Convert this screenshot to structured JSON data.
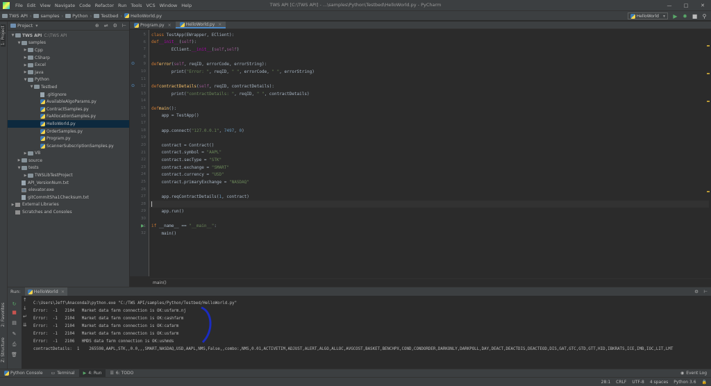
{
  "window": {
    "title": "TWS API [C:\\TWS API] - ...\\samples\\Python\\Testbed\\HelloWorld.py - PyCharm",
    "controls": [
      "—",
      "□",
      "✕"
    ]
  },
  "menu": [
    "File",
    "Edit",
    "View",
    "Navigate",
    "Code",
    "Refactor",
    "Run",
    "Tools",
    "VCS",
    "Window",
    "Help"
  ],
  "breadcrumbs": [
    "TWS API",
    "samples",
    "Python",
    "Testbed",
    "HelloWorld.py"
  ],
  "run_config": "HelloWorld",
  "left_strip": {
    "project": "1: Project",
    "favorites": "2: Favorites",
    "structure": "Z: Structure"
  },
  "project_pane": {
    "title": "Project",
    "tree": [
      {
        "label": "TWS API",
        "extra": "C:\\TWS API",
        "type": "folder",
        "depth": 0,
        "open": true
      },
      {
        "label": "samples",
        "type": "folder",
        "depth": 1,
        "open": true
      },
      {
        "label": "Cpp",
        "type": "folder",
        "depth": 2,
        "open": false
      },
      {
        "label": "CSharp",
        "type": "folder",
        "depth": 2,
        "open": false
      },
      {
        "label": "Excel",
        "type": "folder",
        "depth": 2,
        "open": false
      },
      {
        "label": "Java",
        "type": "folder",
        "depth": 2,
        "open": false
      },
      {
        "label": "Python",
        "type": "folder",
        "depth": 2,
        "open": true
      },
      {
        "label": "Testbed",
        "type": "folder",
        "depth": 3,
        "open": true
      },
      {
        "label": ".gitignore",
        "type": "file",
        "depth": 4
      },
      {
        "label": "AvailableAlgoParams.py",
        "type": "py",
        "depth": 4
      },
      {
        "label": "ContractSamples.py",
        "type": "py",
        "depth": 4
      },
      {
        "label": "FaAllocationSamples.py",
        "type": "py",
        "depth": 4
      },
      {
        "label": "HelloWorld.py",
        "type": "py",
        "depth": 4,
        "selected": true
      },
      {
        "label": "OrderSamples.py",
        "type": "py",
        "depth": 4
      },
      {
        "label": "Program.py",
        "type": "py",
        "depth": 4
      },
      {
        "label": "ScannerSubscriptionSamples.py",
        "type": "py",
        "depth": 4
      },
      {
        "label": "VB",
        "type": "folder",
        "depth": 2,
        "open": false
      },
      {
        "label": "source",
        "type": "folder",
        "depth": 1,
        "open": false
      },
      {
        "label": "tests",
        "type": "folder",
        "depth": 1,
        "open": true
      },
      {
        "label": "TWSLibTestProject",
        "type": "folder",
        "depth": 2,
        "open": false
      },
      {
        "label": "API_VersionNum.txt",
        "type": "file",
        "depth": 1
      },
      {
        "label": "elevator.exe",
        "type": "exe",
        "depth": 1
      },
      {
        "label": "gitCommitSha1Checksum.txt",
        "type": "file",
        "depth": 1
      },
      {
        "label": "External Libraries",
        "type": "lib",
        "depth": 0,
        "open": false
      },
      {
        "label": "Scratches and Consoles",
        "type": "scratch",
        "depth": 0
      }
    ]
  },
  "editor": {
    "tabs": [
      {
        "label": "Program.py",
        "active": false
      },
      {
        "label": "HelloWorld.py",
        "active": true
      }
    ],
    "breadcrumb": "main()",
    "lines": [
      {
        "n": "5",
        "html": "<span class='kw'>class</span> TestApp(EWrapper, EClient):"
      },
      {
        "n": "6",
        "html": "    <span class='kw'>def</span> <span class='magic'>__init__</span>(<span class='self'>self</span>):"
      },
      {
        "n": "7",
        "html": "        EClient.<span class='magic'>__init__</span>(<span class='self'>self</span>,<span class='self'>self</span>)"
      },
      {
        "n": "8",
        "html": ""
      },
      {
        "n": "9",
        "html": "    <span class='kw'>def</span> <span class='fn'>error</span>(<span class='self'>self</span>, reqID, errorCode, errorString):"
      },
      {
        "n": "10",
        "html": "        print(<span class='str'>\"Error: \"</span>, reqID, <span class='str'>\" \"</span>, errorCode, <span class='str'>\" \"</span>, errorString)"
      },
      {
        "n": "11",
        "html": ""
      },
      {
        "n": "12",
        "html": "    <span class='kw'>def</span> <span class='fn'>contractDetails</span>(<span class='self'>self</span>, reqID, contractDetails):"
      },
      {
        "n": "13",
        "html": "        print(<span class='str'>\"contractDetails: \"</span>, reqID, <span class='str'>\" \"</span>, contractDetails)"
      },
      {
        "n": "14",
        "html": ""
      },
      {
        "n": "15",
        "html": "<span class='kw'>def</span> <span class='fn'>main</span>():"
      },
      {
        "n": "16",
        "html": "    app = TestApp()"
      },
      {
        "n": "17",
        "html": ""
      },
      {
        "n": "18",
        "html": "    app.connect(<span class='str'>\"127.0.0.1\"</span>, <span class='num'>7497</span>, <span class='num'>0</span>)"
      },
      {
        "n": "19",
        "html": ""
      },
      {
        "n": "20",
        "html": "    contract = Contract()"
      },
      {
        "n": "21",
        "html": "    contract.symbol = <span class='str'>\"AAPL\"</span>"
      },
      {
        "n": "22",
        "html": "    contract.secType = <span class='str'>\"STK\"</span>"
      },
      {
        "n": "23",
        "html": "    contract.exchange = <span class='str'>\"SMART\"</span>"
      },
      {
        "n": "24",
        "html": "    contract.currency = <span class='str'>\"USD\"</span>"
      },
      {
        "n": "25",
        "html": "    contract.primaryExchange = <span class='str'>\"NASDAQ\"</span>"
      },
      {
        "n": "26",
        "html": ""
      },
      {
        "n": "27",
        "html": "    app.reqContractDetails(<span class='num'>1</span>, contract)"
      },
      {
        "n": "28",
        "html": "",
        "current": true
      },
      {
        "n": "29",
        "html": "    app.run()"
      },
      {
        "n": "30",
        "html": ""
      },
      {
        "n": "31",
        "html": "<span class='kw'>if</span> __name__ == <span class='str'>\"__main__\"</span>:"
      },
      {
        "n": "32",
        "html": "    main()"
      }
    ]
  },
  "run_panel": {
    "label": "Run:",
    "tab": "HelloWorld",
    "console": [
      "C:\\Users\\Jeff\\Anaconda3\\python.exe \"C:/TWS API/samples/Python/Testbed/HelloWorld.py\"",
      "Error:  -1   2104   Market data farm connection is OK:usfarm.nj",
      "Error:  -1   2104   Market data farm connection is OK:cashfarm",
      "Error:  -1   2104   Market data farm connection is OK:cafarm",
      "Error:  -1   2104   Market data farm connection is OK:usfarm",
      "Error:  -1   2106   HMDS data farm connection is OK:ushmds",
      "contractDetails:  1    265598,AAPL,STK,,0.0,,,SMART,NASDAQ,USD,AAPL,NMS,False,,combo:,NMS,0.01,ACTIVETIM,ADJUST,ALERT,ALGO,ALLOC,AVGCOST,BASKET,BENCHPX,COND,CONDORDER,DARKONLY,DARKPOLL,DAY,DEACT,DEACTDIS,DEACTEOD,DIS,GAT,GTC,GTD,GTT,HID,IBKRATS,ICE,IMB,IOC,LIT,LMT"
    ]
  },
  "toolwin": [
    "Python Console",
    "Terminal",
    "4: Run",
    "6: TODO"
  ],
  "event_log": "Event Log",
  "status": {
    "position": "28:1",
    "line_sep": "CRLF",
    "encoding": "UTF-8",
    "indent": "4 spaces",
    "interpreter": "Python 3.6"
  },
  "colors": {
    "accent": "#4a88c7",
    "annotation": "#1b2cc1"
  }
}
